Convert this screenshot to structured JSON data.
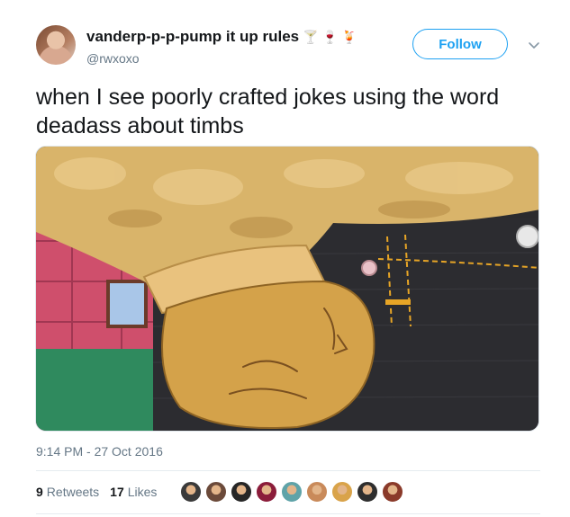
{
  "tweet": {
    "author": {
      "display_name": "vanderp-p-p-pump it up rules",
      "name_emojis": [
        "🍸",
        "🍷",
        "🍹"
      ],
      "handle": "@rwxoxo",
      "avatar_icon": "profile-photo"
    },
    "follow_label": "Follow",
    "more_icon": "chevron-down-icon",
    "text": "when I see poorly crafted jokes using the word deadass about timbs",
    "media": {
      "kind": "photo",
      "colors": {
        "fur": "#d9b46a",
        "fist": "#d4a24a",
        "denim": "#2c2c30",
        "stitching": "#e7a526",
        "building": "#cf4f6c",
        "window_frame": "#2f8a5e"
      }
    },
    "timestamp": "9:14 PM - 27 Oct 2016",
    "stats": {
      "retweets_count": "9",
      "retweets_label": "Retweets",
      "likes_count": "17",
      "likes_label": "Likes"
    },
    "likers": [
      {
        "name": "liker-1",
        "color": "#3a3a3a"
      },
      {
        "name": "liker-2",
        "color": "#6b4a3a"
      },
      {
        "name": "liker-3",
        "color": "#262626"
      },
      {
        "name": "liker-4",
        "color": "#8b1c3a"
      },
      {
        "name": "liker-5",
        "color": "#5fa3a8"
      },
      {
        "name": "liker-6",
        "color": "#c98a5a"
      },
      {
        "name": "liker-7",
        "color": "#d9a34a"
      },
      {
        "name": "liker-8",
        "color": "#2e2e2e"
      },
      {
        "name": "liker-9",
        "color": "#8a3a2a"
      }
    ],
    "colors": {
      "link_blue": "#1da1f2",
      "secondary_text": "#657786",
      "primary_text": "#14171a"
    }
  }
}
